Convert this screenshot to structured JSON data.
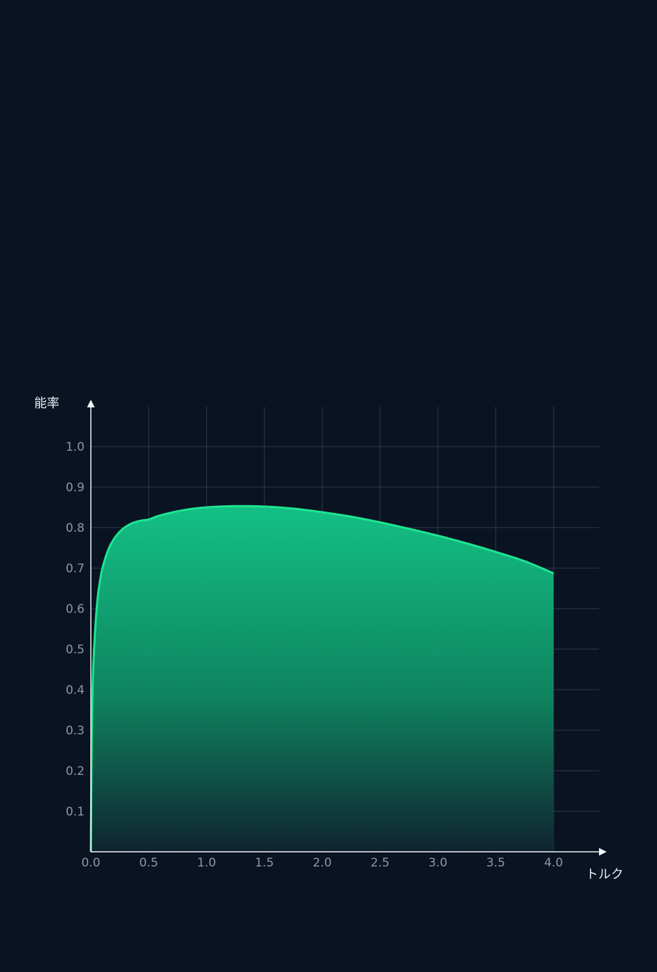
{
  "colors": {
    "background": "#0a1322",
    "curve": "#1ee592",
    "fill_top": "#14c98a",
    "fill_mid": "#0f8a62",
    "fill_bottom": "#0f2430",
    "grid": "#3a4556",
    "axis": "#f2f5f8",
    "tick_text": "#8b97a8",
    "axis_title_text": "#e9eef5"
  },
  "chart_data": {
    "type": "area",
    "title": "",
    "xlabel": "トルク",
    "ylabel": "能率",
    "xlim": [
      0,
      4.4
    ],
    "ylim": [
      0,
      1.1
    ],
    "x_ticks": [
      "0.0",
      "0.5",
      "1.0",
      "1.5",
      "2.0",
      "2.5",
      "3.0",
      "3.5",
      "4.0"
    ],
    "y_ticks": [
      "0.1",
      "0.2",
      "0.3",
      "0.4",
      "0.5",
      "0.6",
      "0.7",
      "0.8",
      "0.9",
      "1.0"
    ],
    "grid": true,
    "series": [
      {
        "x": [
          0.0,
          0.005,
          0.01,
          0.02,
          0.04,
          0.06,
          0.08,
          0.1,
          0.15,
          0.2,
          0.25,
          0.3,
          0.35,
          0.4,
          0.45,
          0.5,
          0.6,
          0.8,
          1.0,
          1.25,
          1.5,
          1.75,
          2.0,
          2.25,
          2.5,
          2.75,
          3.0,
          3.25,
          3.5,
          3.75,
          4.0
        ],
        "y": [
          0.0,
          0.2,
          0.32,
          0.45,
          0.56,
          0.63,
          0.67,
          0.7,
          0.745,
          0.772,
          0.79,
          0.802,
          0.81,
          0.815,
          0.818,
          0.82,
          0.83,
          0.843,
          0.85,
          0.853,
          0.852,
          0.847,
          0.838,
          0.827,
          0.813,
          0.797,
          0.78,
          0.761,
          0.74,
          0.717,
          0.687
        ]
      }
    ]
  }
}
